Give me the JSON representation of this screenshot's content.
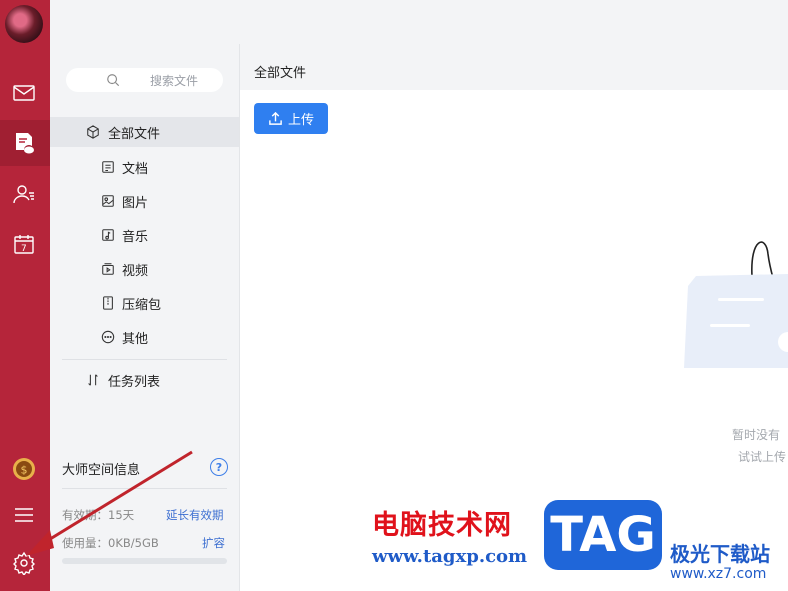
{
  "sidebar_rail": {
    "icons": [
      "mail-icon",
      "cloud-drive-icon",
      "contacts-icon",
      "calendar-icon",
      "coin-icon",
      "menu-icon",
      "settings-icon"
    ],
    "calendar_day": "7"
  },
  "search": {
    "placeholder": "搜索文件"
  },
  "nav": {
    "all_files": "全部文件",
    "docs": "文档",
    "images": "图片",
    "music": "音乐",
    "video": "视频",
    "archive": "压缩包",
    "other": "其他",
    "tasks": "任务列表"
  },
  "storage": {
    "title": "大师空间信息",
    "help": "?",
    "validity_label": "有效期：15天",
    "extend_link": "延长有效期",
    "usage_label": "使用量：0KB/5GB",
    "expand_link": "扩容",
    "usage_fraction": 0
  },
  "main": {
    "header": "全部文件",
    "upload_label": "上传",
    "empty_line1": "暂时没有",
    "empty_line2": "试试上传"
  },
  "watermark": {
    "cn": "电脑技术网",
    "url": "www.tagxp.com",
    "tag": "TAG",
    "site_cn": "极光下载站",
    "site_url": "www.xz7.com"
  },
  "colors": {
    "rail": "#b5253a",
    "accent": "#2f7ff0",
    "link": "#3d6fd1"
  }
}
